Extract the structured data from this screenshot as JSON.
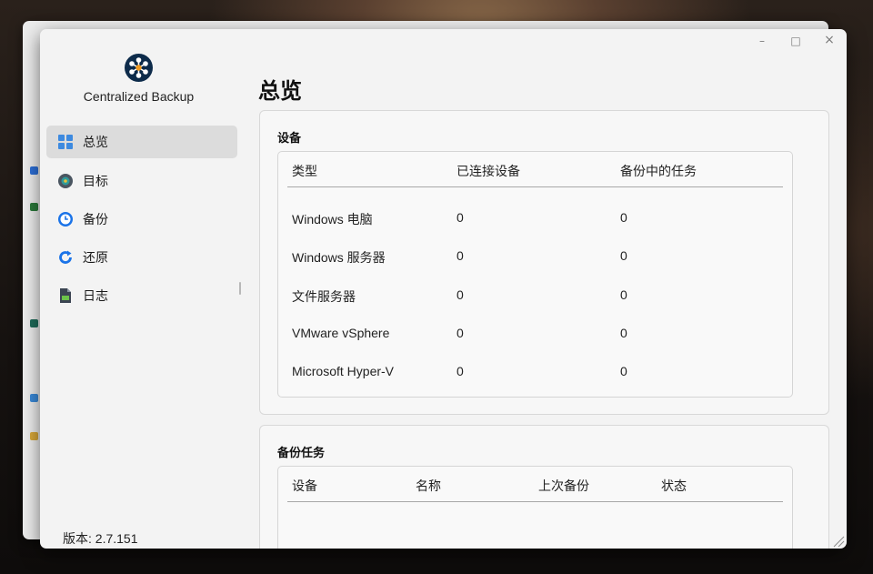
{
  "window_controls": {
    "minimize": "–",
    "maximize": "□",
    "close": "×"
  },
  "app": {
    "name": "Centralized Backup",
    "version": "版本: 2.7.151"
  },
  "sidebar": {
    "items": [
      {
        "label": "总览",
        "icon": "overview-grid-icon",
        "active": true
      },
      {
        "label": "目标",
        "icon": "target-disk-icon",
        "active": false
      },
      {
        "label": "备份",
        "icon": "backup-clock-icon",
        "active": false
      },
      {
        "label": "还原",
        "icon": "restore-refresh-icon",
        "active": false
      },
      {
        "label": "日志",
        "icon": "log-document-icon",
        "active": false
      }
    ]
  },
  "main": {
    "title": "总览",
    "devices": {
      "title": "设备",
      "columns": [
        "类型",
        "已连接设备",
        "备份中的任务"
      ],
      "rows": [
        [
          "Windows 电脑",
          "0",
          "0"
        ],
        [
          "Windows 服务器",
          "0",
          "0"
        ],
        [
          "文件服务器",
          "0",
          "0"
        ],
        [
          "VMware vSphere",
          "0",
          "0"
        ],
        [
          "Microsoft Hyper-V",
          "0",
          "0"
        ]
      ]
    },
    "backup_tasks": {
      "title": "备份任务",
      "columns": [
        "设备",
        "名称",
        "上次备份",
        "状态"
      ]
    }
  },
  "colors": {
    "accent": "#1a73e8",
    "nav_active_bg": "#dcdcdc",
    "logo_bg": "#0d2b4a"
  }
}
